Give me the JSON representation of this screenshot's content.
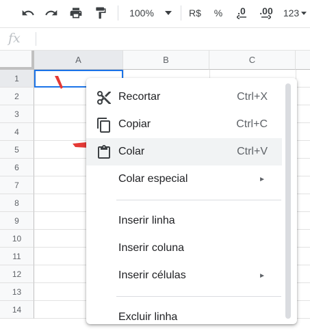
{
  "toolbar": {
    "zoom": "100%",
    "currency": "R$",
    "percent": "%",
    "dec_decrease": ".0",
    "dec_increase": ".00",
    "more_formats": "123"
  },
  "formula_bar": {
    "fx": "fx",
    "value": ""
  },
  "columns": [
    "A",
    "B",
    "C"
  ],
  "rows": [
    "1",
    "2",
    "3",
    "4",
    "5",
    "6",
    "7",
    "8",
    "9",
    "10",
    "11",
    "12",
    "13",
    "14"
  ],
  "context_menu": {
    "items": [
      {
        "label": "Recortar",
        "shortcut": "Ctrl+X",
        "icon": "scissors-icon"
      },
      {
        "label": "Copiar",
        "shortcut": "Ctrl+C",
        "icon": "copy-icon"
      },
      {
        "label": "Colar",
        "shortcut": "Ctrl+V",
        "icon": "clipboard-icon"
      },
      {
        "label": "Colar especial",
        "submenu": "►"
      },
      {
        "label": "Inserir linha"
      },
      {
        "label": "Inserir coluna"
      },
      {
        "label": "Inserir células",
        "submenu": "►"
      },
      {
        "label": "Excluir linha"
      }
    ]
  },
  "colors": {
    "selection": "#1a73e8",
    "annotation": "#e53935"
  }
}
